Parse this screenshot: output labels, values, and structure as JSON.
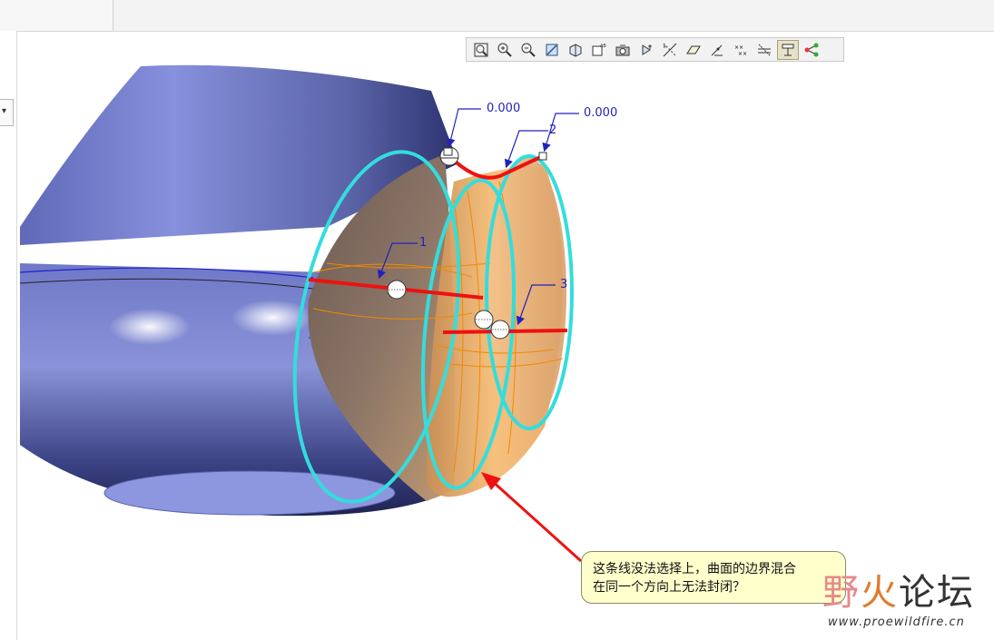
{
  "toolbar": {
    "buttons": [
      {
        "name": "refit-view",
        "icon": "refit-icon"
      },
      {
        "name": "zoom-in",
        "icon": "zoom-in-icon"
      },
      {
        "name": "zoom-out",
        "icon": "zoom-out-icon"
      },
      {
        "name": "repaint",
        "icon": "repaint-icon"
      },
      {
        "name": "display-style",
        "icon": "display-style-icon"
      },
      {
        "name": "saved-views",
        "icon": "saved-views-icon"
      },
      {
        "name": "view-manager",
        "icon": "view-manager-icon"
      },
      {
        "name": "spin-center",
        "icon": "spin-center-icon"
      },
      {
        "name": "datum-axes",
        "icon": "datum-axes-icon"
      },
      {
        "name": "datum-planes",
        "icon": "datum-planes-icon"
      },
      {
        "name": "point-display",
        "icon": "point-display-icon"
      },
      {
        "name": "coordinate-systems",
        "icon": "coordinate-systems-icon"
      },
      {
        "name": "annotations",
        "icon": "annotations-icon"
      },
      {
        "name": "model-tree-toggle",
        "icon": "model-tree-icon",
        "active": true
      },
      {
        "name": "network",
        "icon": "network-icon"
      }
    ]
  },
  "dimensions": {
    "top_left": "0.000",
    "top_right": "0.000",
    "label_1": "1",
    "label_2": "2",
    "label_3": "3"
  },
  "callout": {
    "line1": "这条线没法选择上，曲面的边界混合",
    "line2": "在同一个方向上无法封闭？"
  },
  "watermark": {
    "c1": "野",
    "c2": "火",
    "c3": "论坛",
    "url": "www.proewildfire.cn"
  },
  "colors": {
    "background": "#ffffff",
    "accent_cyan": "#33dddd",
    "boundary_red": "#ee1111",
    "dimension_blue": "#2222bb",
    "model_blue": "#7c86cf",
    "surface_orange": "#f2b36a"
  }
}
